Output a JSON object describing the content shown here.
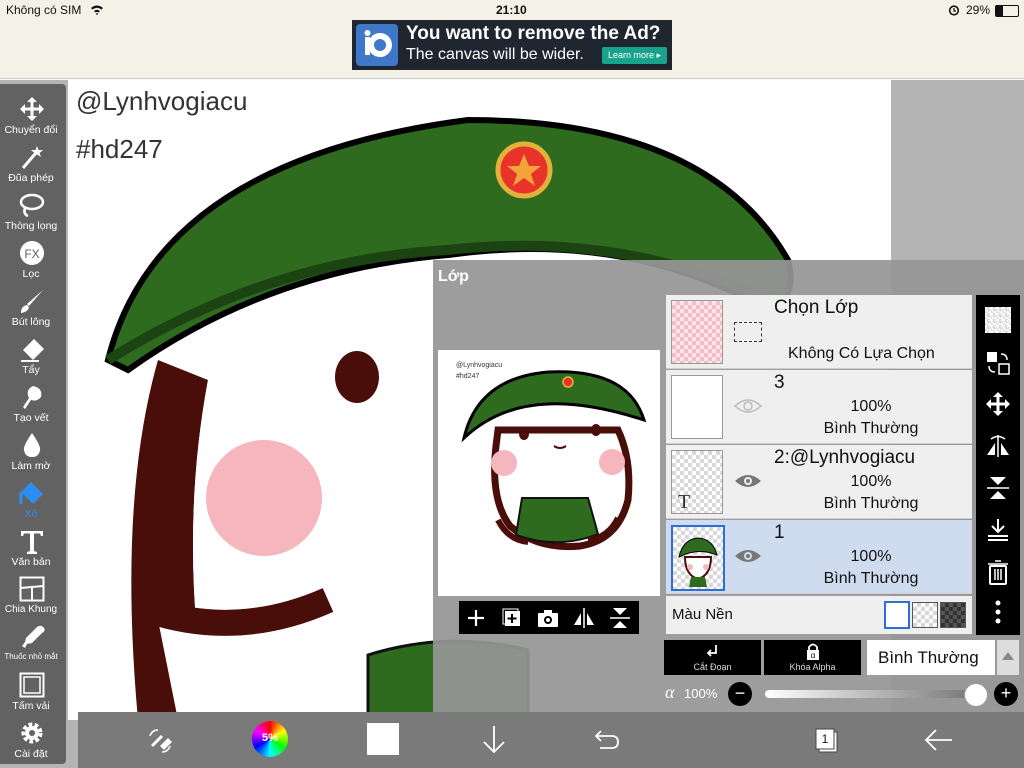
{
  "status": {
    "carrier": "Không có SIM",
    "time": "21:10",
    "battery": "29%"
  },
  "ad": {
    "title": "You want to remove the Ad?",
    "subtitle": "The canvas will be wider.",
    "button": "Learn more ▸"
  },
  "canvas": {
    "watermark_line1": "@Lynhvogiacu",
    "watermark_line2": "#hd247"
  },
  "tools": [
    {
      "label": "Chuyển đổi",
      "icon": "move-icon"
    },
    {
      "label": "Đũa phép",
      "icon": "magic-wand-icon"
    },
    {
      "label": "Thòng lọng",
      "icon": "lasso-icon"
    },
    {
      "label": "Lọc",
      "icon": "fx-icon"
    },
    {
      "label": "Bút lông",
      "icon": "brush-icon"
    },
    {
      "label": "Tẩy",
      "icon": "eraser-icon"
    },
    {
      "label": "Tạo vết",
      "icon": "smudge-icon"
    },
    {
      "label": "Làm mờ",
      "icon": "blur-icon"
    },
    {
      "label": "Xô",
      "icon": "bucket-icon"
    },
    {
      "label": "Văn bản",
      "icon": "text-icon"
    },
    {
      "label": "Chia Khung",
      "icon": "frame-divider-icon"
    },
    {
      "label": "Thuốc nhỏ mắt",
      "icon": "eyedropper-icon"
    },
    {
      "label": "Tấm vải",
      "icon": "canvas-icon"
    },
    {
      "label": "Cài đặt",
      "icon": "settings-icon"
    }
  ],
  "bottom": {
    "color_wheel_label": "5%",
    "layer_count": "1"
  },
  "layers_panel": {
    "title": "Lớp",
    "preview_line1": "@Lynhvogiacu",
    "preview_line2": "#hd247",
    "selection_row": {
      "name": "Chọn Lớp",
      "status": "Không Có Lựa Chọn"
    },
    "layers": [
      {
        "name": "3",
        "opacity": "100%",
        "mode": "Bình Thường"
      },
      {
        "name": "2:@Lynhvogiacu",
        "opacity": "100%",
        "mode": "Bình Thường"
      },
      {
        "name": "1",
        "opacity": "100%",
        "mode": "Bình Thường"
      }
    ],
    "background_label": "Màu Nền",
    "clip_label": "Cắt Đoạn",
    "alpha_lock_label": "Khóa Alpha",
    "blend_mode": "Bình Thường",
    "alpha_symbol": "α",
    "alpha_value": "100%",
    "alpha_level": 1.0
  },
  "colors": {
    "accent": "#2c8ef0",
    "helmet": "#2e6b1f",
    "outline": "#4a0e0a",
    "cheek": "#f6b6bd",
    "star": "#e8322a"
  }
}
